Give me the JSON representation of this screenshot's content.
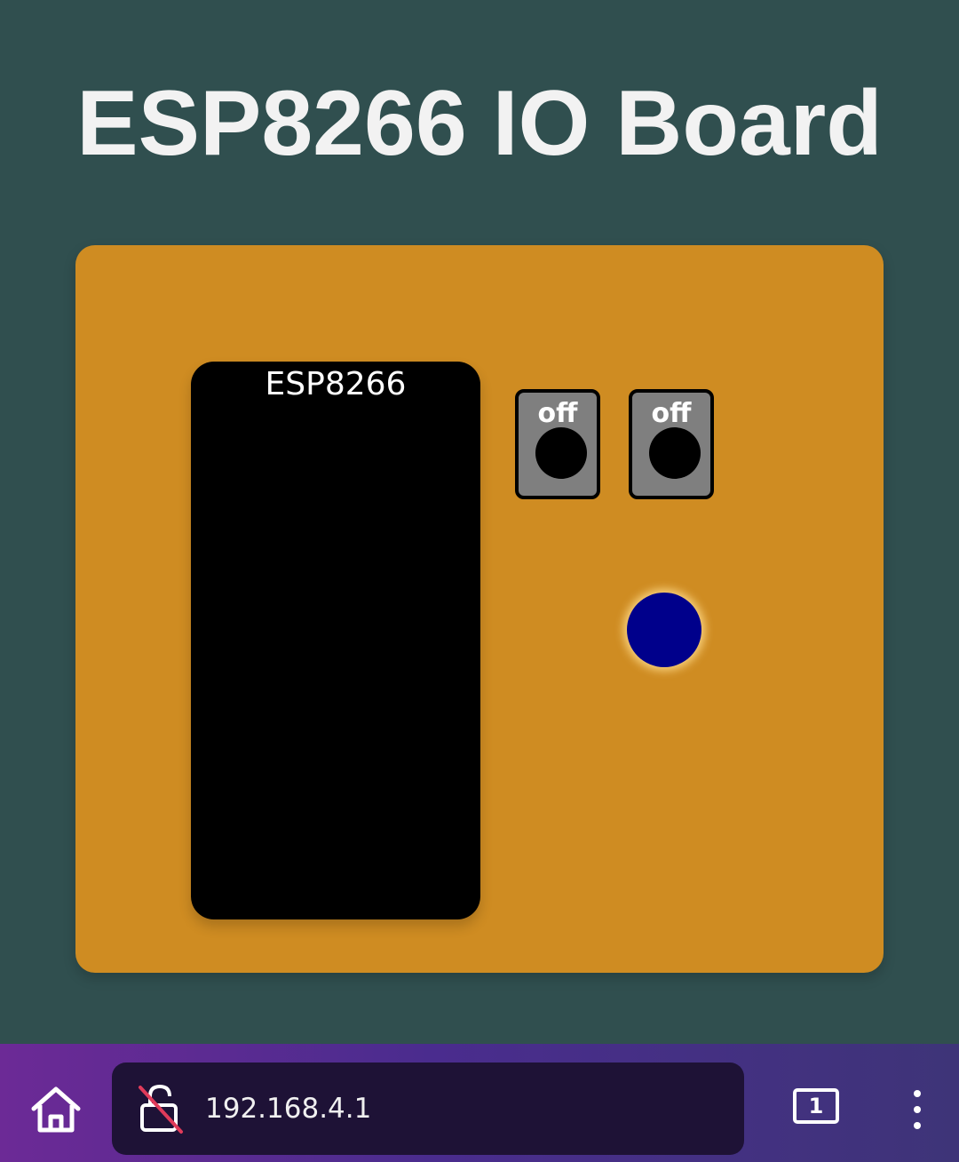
{
  "page": {
    "title": "ESP8266 IO Board",
    "background_color": "#304f4f"
  },
  "board": {
    "color": "#cf8c22",
    "chip": {
      "label": "ESP8266"
    },
    "switches": [
      {
        "label": "off"
      },
      {
        "label": "off"
      }
    ],
    "led": {
      "color": "#00008b",
      "state": "on"
    }
  },
  "browser": {
    "url": "192.168.4.1",
    "tab_count": "1",
    "icons": {
      "home": "home-icon",
      "security": "lock-open-crossed-icon",
      "tabs": "tabs-icon",
      "menu": "more-vert-icon"
    }
  }
}
